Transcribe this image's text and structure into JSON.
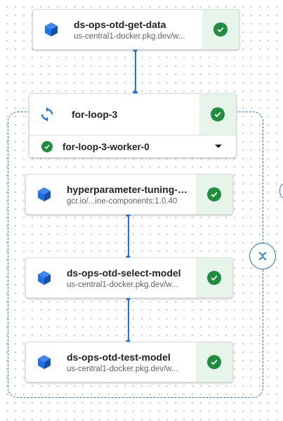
{
  "nodes": {
    "get_data": {
      "title": "ds-ops-otd-get-data",
      "subtitle": "us-central1-docker.pkg.dev/w...",
      "icon": "cube-icon",
      "status": "succeeded"
    },
    "loop": {
      "title": "for-loop-3",
      "icon": "loop-icon",
      "status": "succeeded",
      "worker": {
        "label": "for-loop-3-worker-0",
        "status": "succeeded"
      }
    },
    "tuning": {
      "title": "hyperparameter-tuning-job",
      "subtitle": "gcr.io/...ine-components:1.0.40",
      "icon": "cube-icon",
      "status": "succeeded"
    },
    "select_model": {
      "title": "ds-ops-otd-select-model",
      "subtitle": "us-central1-docker.pkg.dev/w...",
      "icon": "cube-icon",
      "status": "succeeded"
    },
    "test_model": {
      "title": "ds-ops-otd-test-model",
      "subtitle": "us-central1-docker.pkg.dev/w...",
      "icon": "cube-icon",
      "status": "succeeded"
    }
  },
  "colors": {
    "accent": "#1a73e8",
    "success": "#1e8e3e",
    "success_bg": "#e6f4ea"
  }
}
